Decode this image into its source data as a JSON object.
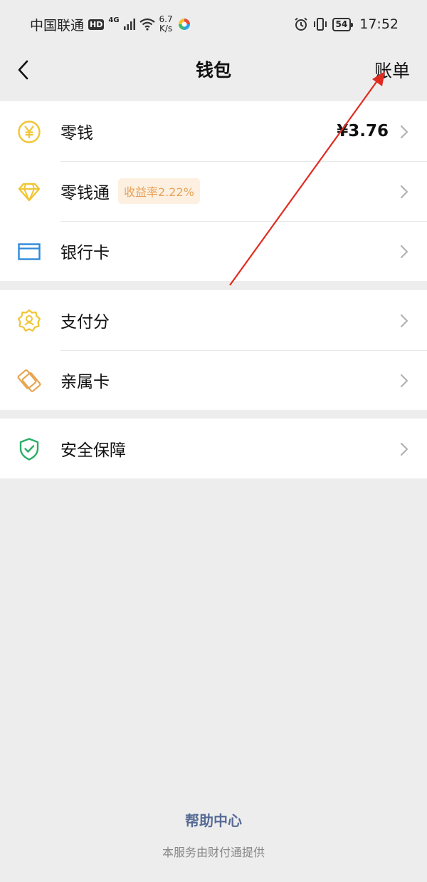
{
  "status_bar": {
    "carrier": "中国联通",
    "hd": "HD",
    "network": "4G",
    "speed_value": "6.7",
    "speed_unit": "K/s",
    "battery": "54",
    "time": "17:52"
  },
  "nav": {
    "title": "钱包",
    "bill_label": "账单"
  },
  "groups": {
    "balance": {
      "change": {
        "label": "零钱",
        "value": "¥3.76"
      },
      "licaitong": {
        "label": "零钱通",
        "badge": "收益率2.22%"
      },
      "bank_card": {
        "label": "银行卡"
      }
    },
    "services": {
      "pay_score": {
        "label": "支付分"
      },
      "family_card": {
        "label": "亲属卡"
      }
    },
    "security": {
      "guarantee": {
        "label": "安全保障"
      }
    }
  },
  "footer": {
    "help_label": "帮助中心",
    "provider_text": "本服务由财付通提供"
  },
  "colors": {
    "background": "#ededed",
    "icon_yellow": "#f0c533",
    "icon_blue": "#2e8ad8",
    "icon_orange": "#e8a450",
    "icon_green": "#2aae67",
    "link_blue": "#576b95",
    "annotation_red": "#e02b20"
  }
}
